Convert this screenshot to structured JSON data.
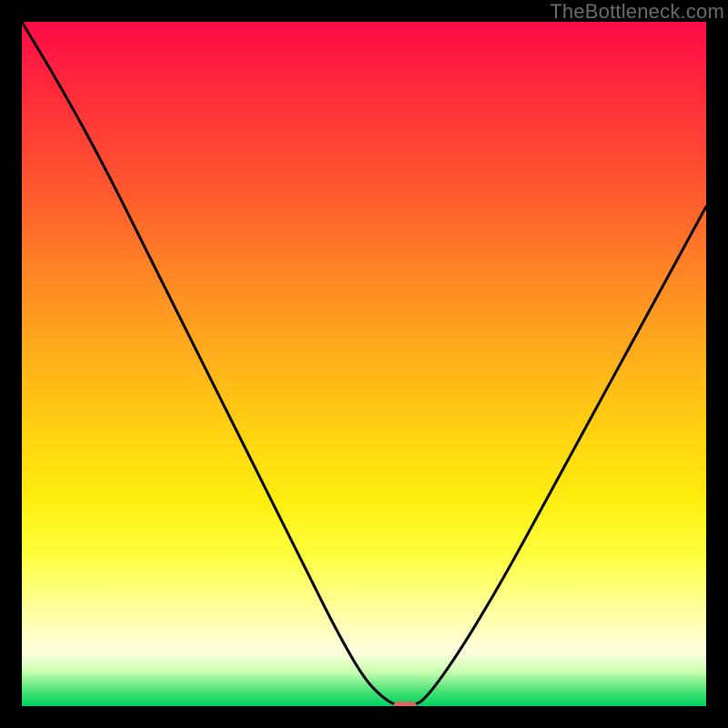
{
  "watermark": {
    "text": "TheBottleneck.com"
  },
  "chart_data": {
    "type": "line",
    "title": "",
    "xlabel": "",
    "ylabel": "",
    "xlim": [
      0,
      100
    ],
    "ylim": [
      0,
      100
    ],
    "grid": false,
    "legend": false,
    "series": [
      {
        "name": "bottleneck-curve",
        "x": [
          0,
          6,
          12,
          18,
          24,
          30,
          36,
          42,
          46,
          50,
          53,
          55,
          57,
          59,
          64,
          70,
          76,
          82,
          88,
          94,
          100
        ],
        "y": [
          100,
          90,
          79,
          67,
          55,
          43,
          31,
          19,
          11,
          4,
          1,
          0,
          0,
          1,
          8,
          18,
          29,
          40,
          51,
          62,
          73
        ]
      }
    ],
    "marker": {
      "name": "optimal-point",
      "x": 56,
      "y": 0,
      "width_frac": 0.035,
      "height_frac": 0.014,
      "color": "#d86a62"
    },
    "background_gradient": {
      "stops": [
        {
          "pos": 0.0,
          "color": "#ff0b48"
        },
        {
          "pos": 0.5,
          "color": "#ffb21a"
        },
        {
          "pos": 0.78,
          "color": "#ffff40"
        },
        {
          "pos": 0.95,
          "color": "#c8ffb0"
        },
        {
          "pos": 1.0,
          "color": "#00d060"
        }
      ]
    }
  }
}
